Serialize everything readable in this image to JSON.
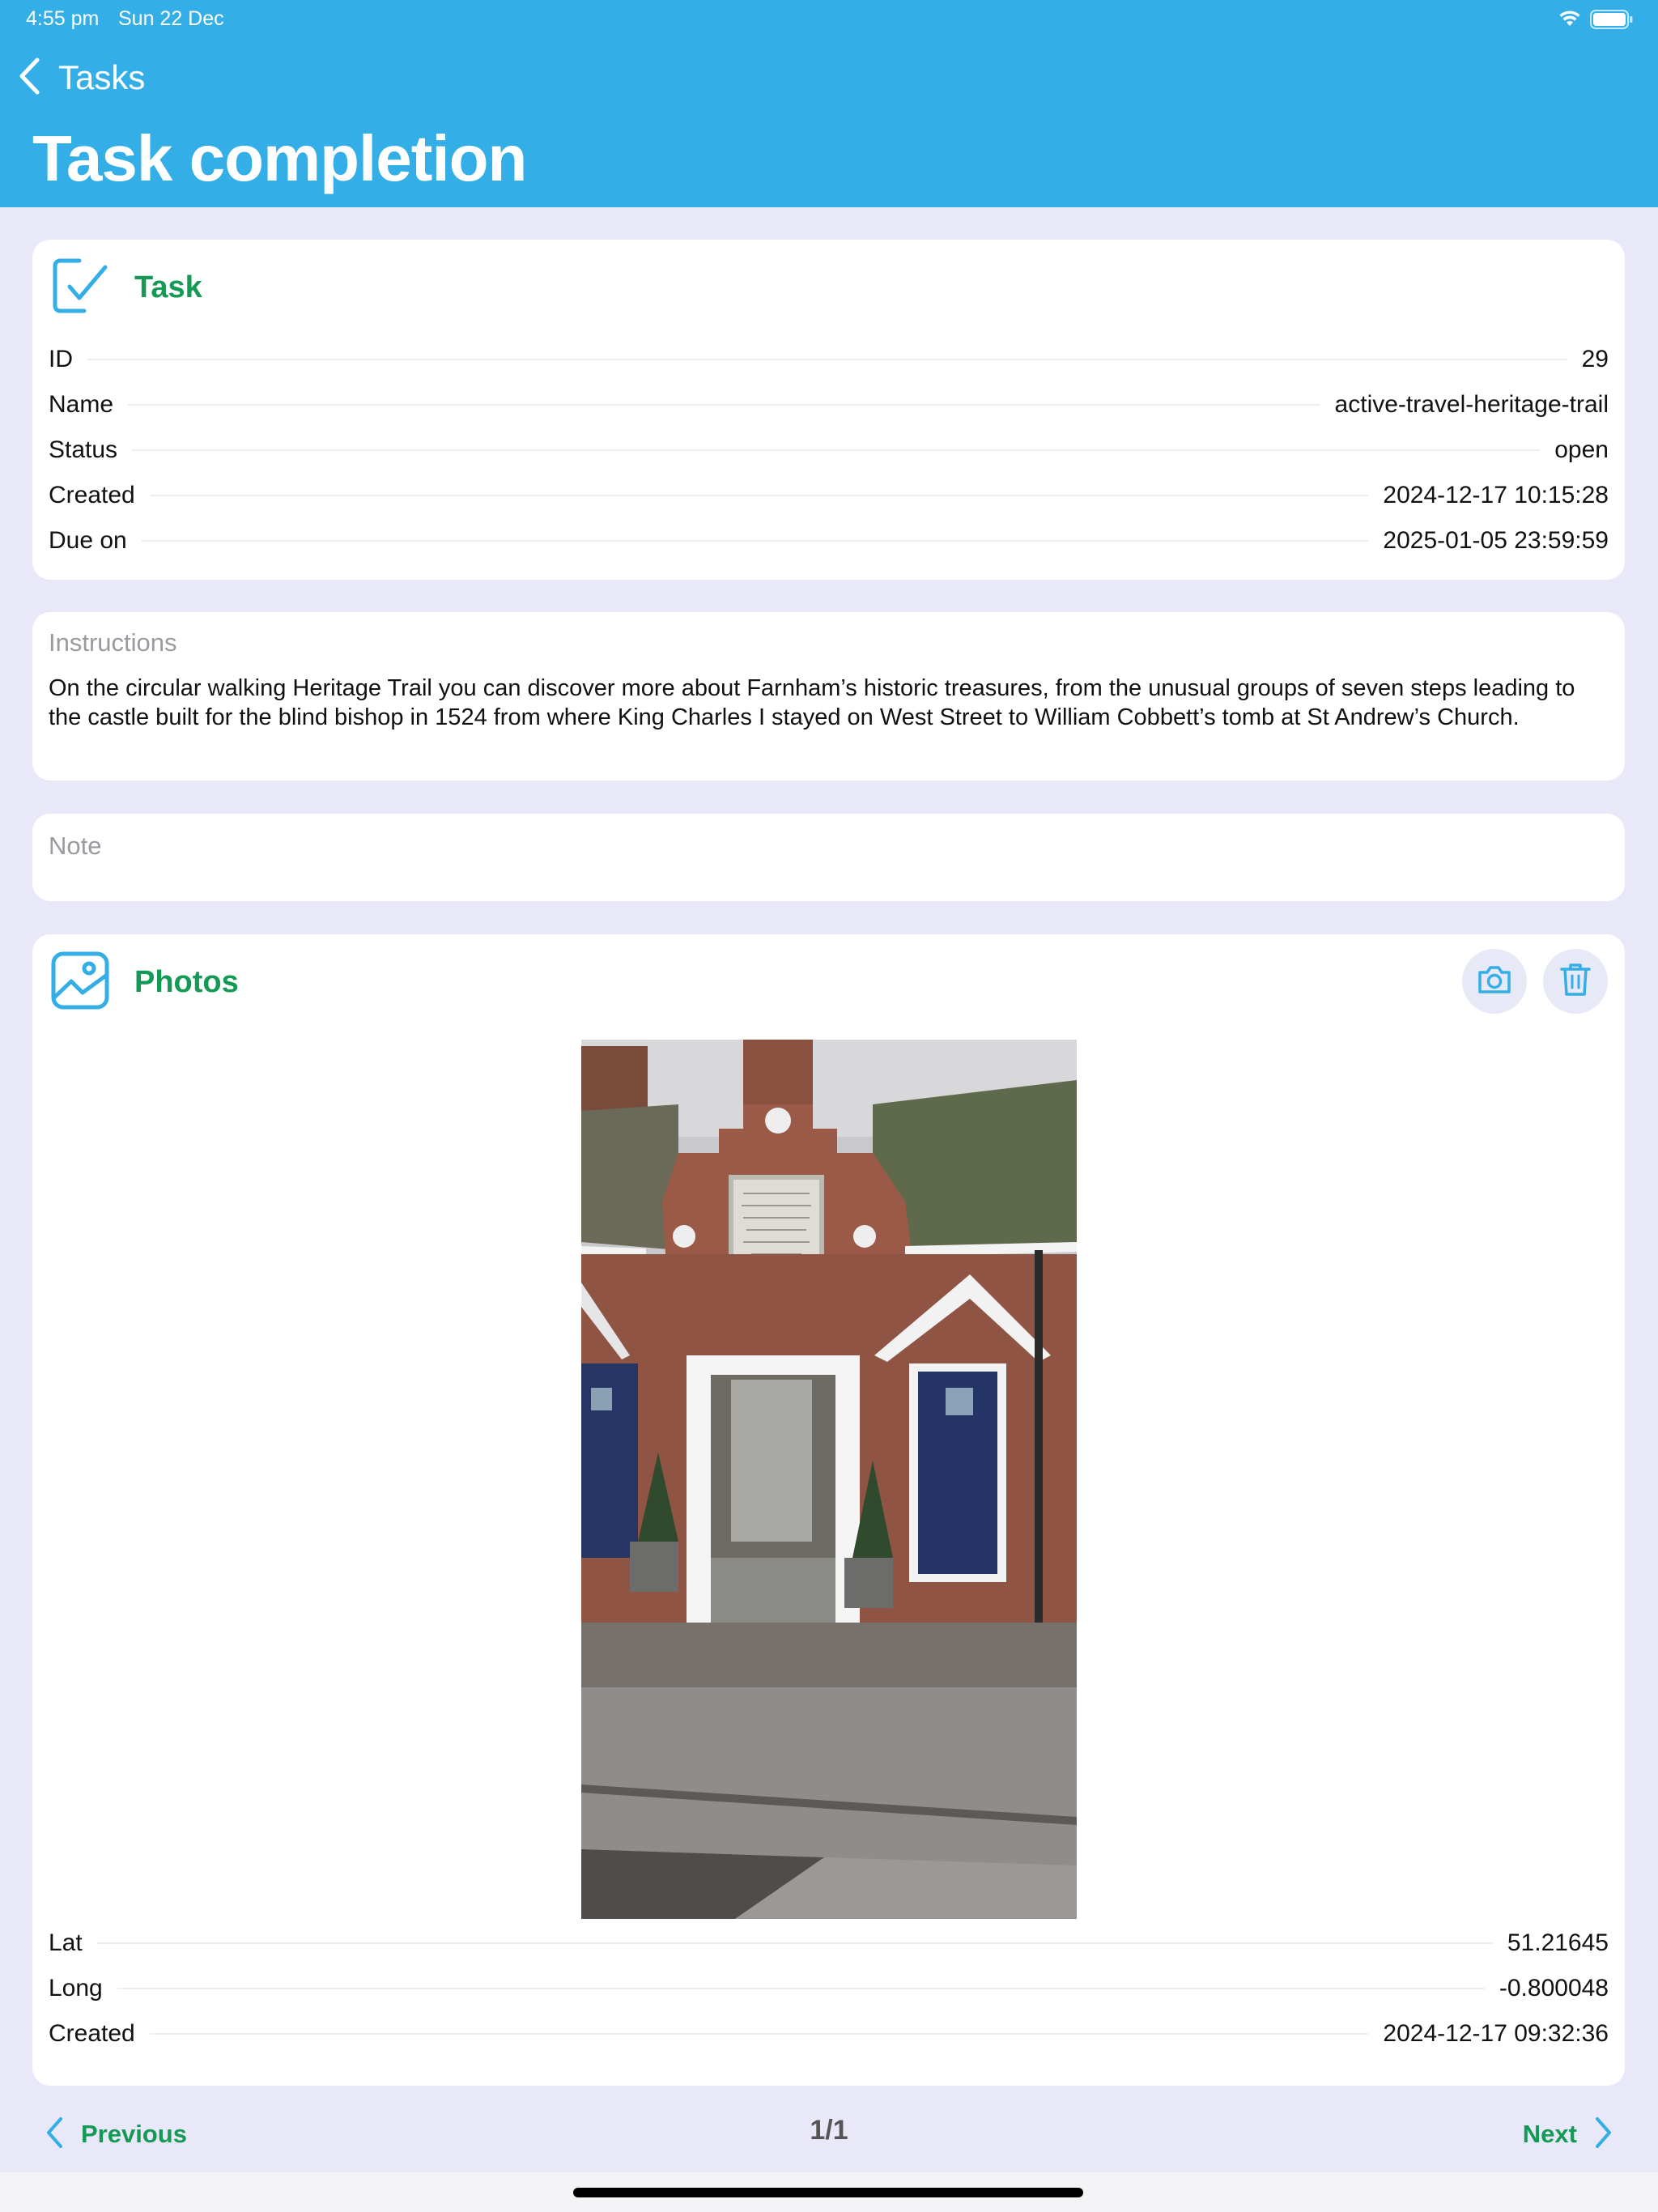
{
  "status_bar": {
    "time": "4:55 pm",
    "date": "Sun 22 Dec",
    "wifi_icon": "wifi-icon",
    "battery_icon": "battery-icon"
  },
  "nav": {
    "back_label": "Tasks",
    "back_icon": "chevron-left-icon",
    "title": "Task completion"
  },
  "task_card": {
    "title": "Task",
    "icon": "checklist-icon",
    "rows": [
      {
        "label": "ID",
        "value": "29"
      },
      {
        "label": "Name",
        "value": "active-travel-heritage-trail"
      },
      {
        "label": "Status",
        "value": "open"
      },
      {
        "label": "Created",
        "value": "2024-12-17 10:15:28"
      },
      {
        "label": "Due on",
        "value": "2025-01-05 23:59:59"
      }
    ]
  },
  "instructions": {
    "label": "Instructions",
    "text": "On the circular walking Heritage Trail you can discover more about Farnham’s historic treasures, from the unusual groups of seven steps leading to the castle built for the blind bishop in 1524 from where King Charles I stayed on West Street to William Cobbett’s tomb at St Andrew’s Church."
  },
  "note": {
    "placeholder": "Note"
  },
  "photos_card": {
    "title": "Photos",
    "icon": "photo-icon",
    "camera_icon": "camera-icon",
    "delete_icon": "trash-icon",
    "rows": [
      {
        "label": "Lat",
        "value": "51.21645"
      },
      {
        "label": "Long",
        "value": "-0.800048"
      },
      {
        "label": "Created",
        "value": "2024-12-17 09:32:36"
      }
    ]
  },
  "pager": {
    "previous_label": "Previous",
    "next_label": "Next",
    "position": "1/1"
  },
  "colors": {
    "header": "#33aee6",
    "accent_green": "#159a56",
    "icon_blue": "#33aee6",
    "background": "#e9e8f9"
  }
}
